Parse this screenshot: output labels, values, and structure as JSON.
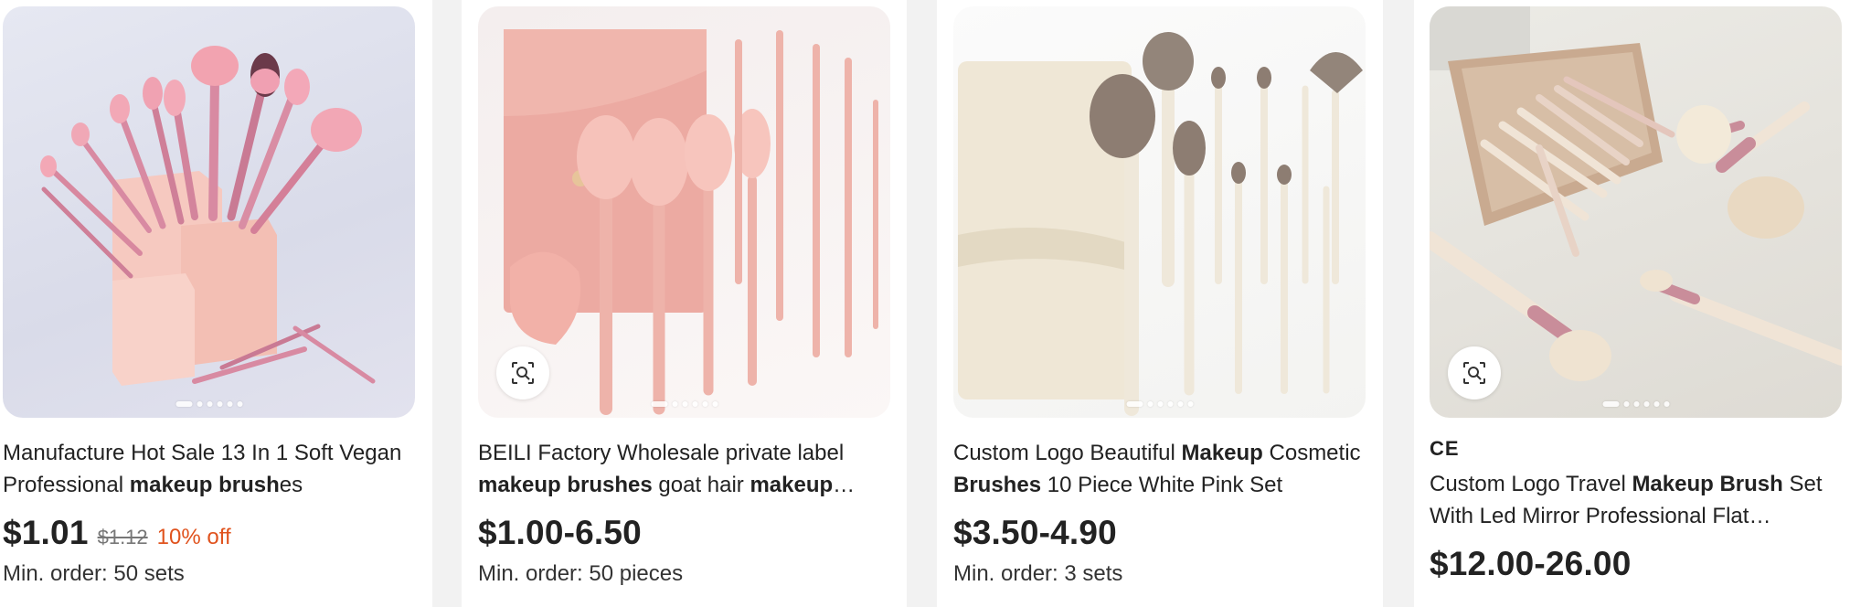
{
  "products": [
    {
      "title_parts": [
        {
          "text": "Manufacture Hot Sale 13 In 1 Soft Vegan Professional ",
          "bold": false
        },
        {
          "text": "makeup brush",
          "bold": true
        },
        {
          "text": "es",
          "bold": false
        }
      ],
      "price": "$1.01",
      "old_price": "$1.12",
      "discount": "10% off",
      "moq": "Min. order: 50 sets",
      "image_dots": 6
    },
    {
      "title_parts": [
        {
          "text": "BEILI Factory Wholesale private label ",
          "bold": false
        },
        {
          "text": "makeup brushes",
          "bold": true
        },
        {
          "text": " goat hair ",
          "bold": false
        },
        {
          "text": "makeup brush",
          "bold": true
        }
      ],
      "price": "$1.00-6.50",
      "moq": "Min. order: 50 pieces",
      "image_dots": 6
    },
    {
      "title_parts": [
        {
          "text": "Custom Logo Beautiful ",
          "bold": false
        },
        {
          "text": "Makeup",
          "bold": true
        },
        {
          "text": " Cosmetic ",
          "bold": false
        },
        {
          "text": "Brushes",
          "bold": true
        },
        {
          "text": " 10 Piece White Pink Set",
          "bold": false
        }
      ],
      "price": "$3.50-4.90",
      "moq": "Min. order: 3 sets",
      "image_dots": 6
    },
    {
      "certification": "CE",
      "title_parts": [
        {
          "text": "Custom Logo Travel ",
          "bold": false
        },
        {
          "text": "Makeup Brush",
          "bold": true
        },
        {
          "text": " Set With Led Mirror Professional Flat Foundation",
          "bold": false
        }
      ],
      "price": "$12.00-26.00",
      "image_dots": 6
    }
  ],
  "icons": {
    "image_search": "image-search-icon"
  },
  "colors": {
    "discount": "#e0531e",
    "price": "#222222",
    "background": "#f2f2f2"
  }
}
